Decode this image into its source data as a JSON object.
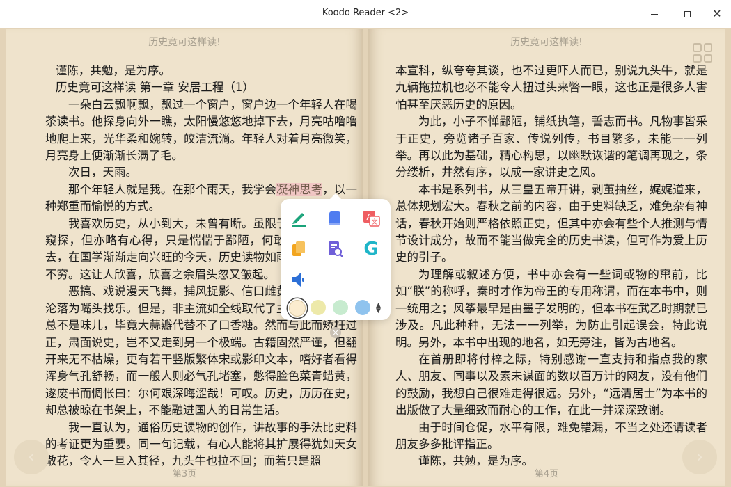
{
  "window": {
    "title": "Koodo Reader <2>"
  },
  "book": {
    "title": "历史竟可这样读!"
  },
  "left_page": {
    "header": "历史竟可这样读!",
    "footer": "第3页",
    "paragraphs": [
      "谨陈，共勉，是为序。",
      "历史竟可这样读 第一章 安居工程（1）",
      "一朵白云飘啊飘，飘过一个窗户，窗户边一个年轻人在喝茶读书。他探身向外一瞧，太阳慢悠悠地掉下去，月亮咕噜噜地爬上来，光华柔和婉转，皎洁流淌。年轻人对着月亮微笑，月亮身上便渐渐长满了毛。",
      "次日，天雨。",
      {
        "before": "那个年轻人就是我。在那个雨天，我学会",
        "highlight": "凝神思考",
        "after": "，以一种郑重而愉悦的方式。"
      },
      "我喜欢历史，从小到大，未曾有断。虽限于专业，我只能窥探，但亦略有心得，只是惴惴于鄙陋，何敢示人。放眼望去，在国学渐渐走向兴旺的今天，历史读物如雨后春笋，层出不穷。这让人欣喜，欣喜之余眉头忽又皱起。",
      "恶搞、戏说漫天飞舞，捕风捉影、信口雌黄比比皆是，皆沦落为嘴头找乐。但是，非主流如全线取代了主流，人们口里总不是味儿，毕竟大蒜瓣代替不了口香糖。然而与此而矫枉过正，肃面说史，岂不又走到另一个极端。古籍固然严谨，但翻开来无不枯燥，更有若干竖版繁体宋或影印文本，嗜好者看得浑身气孔舒畅，而一般人则必气孔堵塞，憋得脸色菜青蜡黄，遂废书而惆怅曰：尔何艰深晦涩哉！可叹。历史，历历在史，却总被晾在书架上，不能融进国人的日常生活。",
      "我一直认为，通俗历史读物的创作，讲故事的手法比史料的考证更为重要。同一句记载，有心人能将其扩展得犹如天女散花，令人一旦入其径，九头牛也拉不回；而若只是照"
    ]
  },
  "right_page": {
    "header": "历史竟可这样读!",
    "footer": "第4页",
    "paragraphs": [
      "本宣科，纵夸夸其谈，也不过更吓人而已，别说九头牛，就是九辆拖拉机也必不能令人扭过头来瞥一眼，这也正是很多人害怕甚至厌恶历史的原因。",
      "为此，小子不惮鄙陋，铺纸执笔，誓志而书。凡物事皆采于正史，旁览诸子百家、传说列传，书目繁多，未能一一列举。再以此为基础，精心构思，以幽默诙谐的笔调再现之，条分缕析，井然有序，以成一家讲史之风。",
      "本书是系列书，从三皇五帝开讲，剥茧抽丝，娓娓道来，总体规划宏大。春秋之前的内容，由于史料缺乏，难免杂有神话，春秋开始则严格依照正史，但其中亦会有些个人推测与情节设计成分，故而不能当做完全的历史书读，但可作为爱上历史的引子。",
      "为理解或叙述方便，书中亦会有一些词或物的窜前，比如“朕”的称呼，秦时才作为帝王的专用称谓，而在本书中，则一统用之；风筝最早是由墨子发明的，但本书在武乙时期就已涉及。凡此种种，无法一一列举，为防止引起误会，特此说明。另外，本书中出现的地名，如无旁注，皆为古地名。",
      "在首册即将付梓之际，特别感谢一直支持和指点我的家人、朋友、同事以及素未谋面的数以百万计的网友，没有他们的鼓励，我想自己很难走得很远。另外，“远清居士”为本书的出版做了大量细致而耐心的工作，在此一并深深致谢。",
      "由于时间仓促，水平有限，难免错漏，不当之处还请读者朋友多多批评指正。",
      "谨陈，共勉，是为序。"
    ]
  },
  "popup": {
    "actions": [
      {
        "icon": "highlighter-icon",
        "color": "#1aa37a"
      },
      {
        "icon": "bookmark-note-icon",
        "color": "#4f7cf0"
      },
      {
        "icon": "translate-icon",
        "color": "#ef5e62"
      },
      {
        "icon": "copy-icon",
        "color": "#f2a51f"
      },
      {
        "icon": "search-in-book-icon",
        "color": "#6f5fd8"
      },
      {
        "icon": "google-search-icon",
        "color": "#1fb5c8"
      },
      {
        "icon": "speaker-icon",
        "color": "#2c6fd6"
      }
    ],
    "highlight_colors": [
      "#fbeccf",
      "#ede9a9",
      "#c7ebcf",
      "#8fc3ee"
    ],
    "selected_color_index": 0
  },
  "colors": {
    "page_background": "#efe3cc",
    "highlight": "#f1c7c4"
  }
}
